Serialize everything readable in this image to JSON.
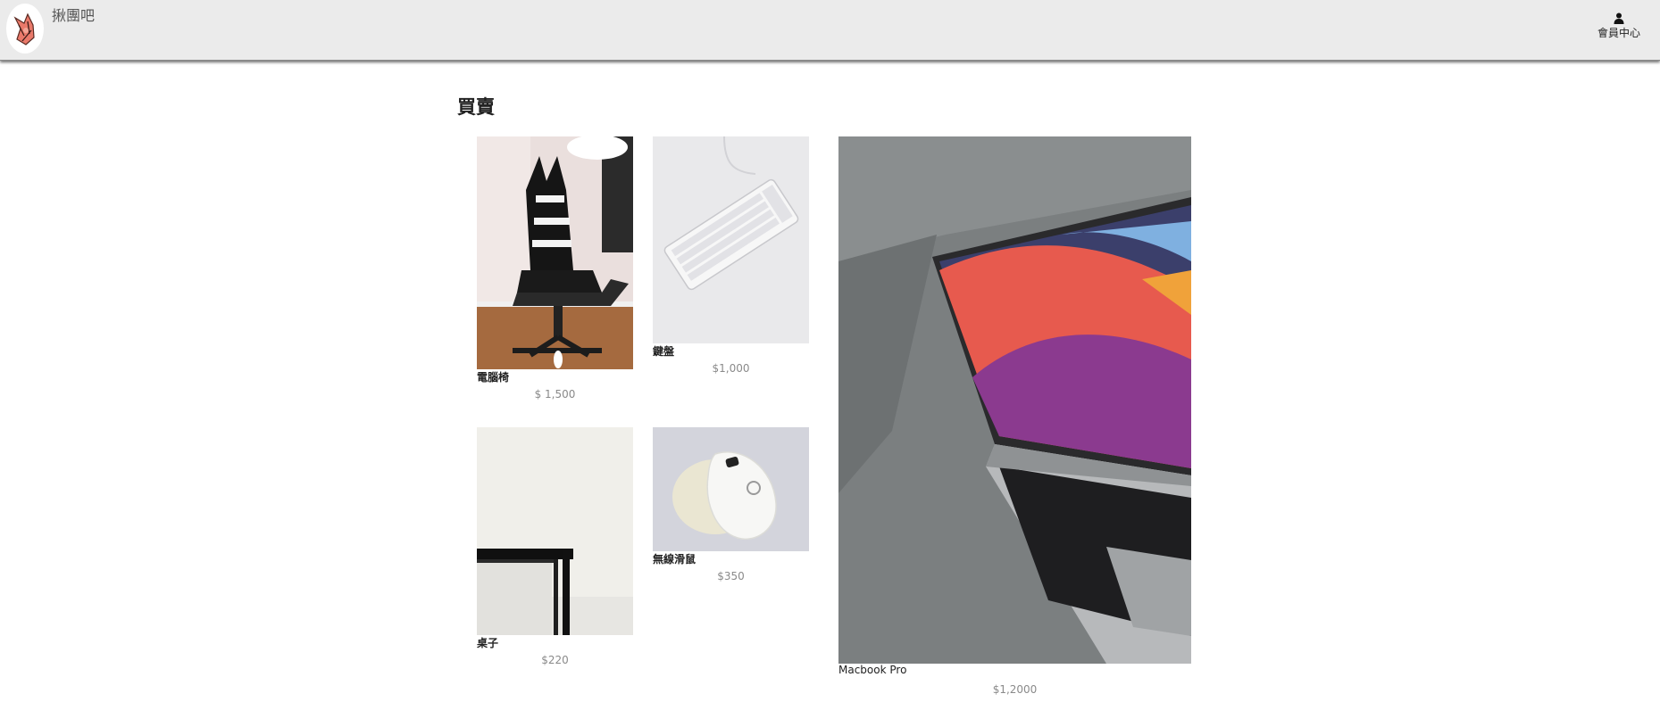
{
  "header": {
    "brand": "揪團吧",
    "member_label": "會員中心",
    "logo_icon": "fox-logo-icon",
    "member_icon": "user-icon"
  },
  "page": {
    "title": "買賣"
  },
  "products": [
    {
      "name": "電腦椅",
      "price": "$ 1,500",
      "image": "gaming-chair-photo"
    },
    {
      "name": "鍵盤",
      "price": "$1,000",
      "image": "white-keyboard-photo"
    },
    {
      "name": "Macbook Pro",
      "price": "$1,2000",
      "image": "macbook-photo"
    },
    {
      "name": "桌子",
      "price": "$220",
      "image": "black-table-photo"
    },
    {
      "name": "無線滑鼠",
      "price": "$350",
      "image": "wireless-mouse-photo"
    }
  ]
}
